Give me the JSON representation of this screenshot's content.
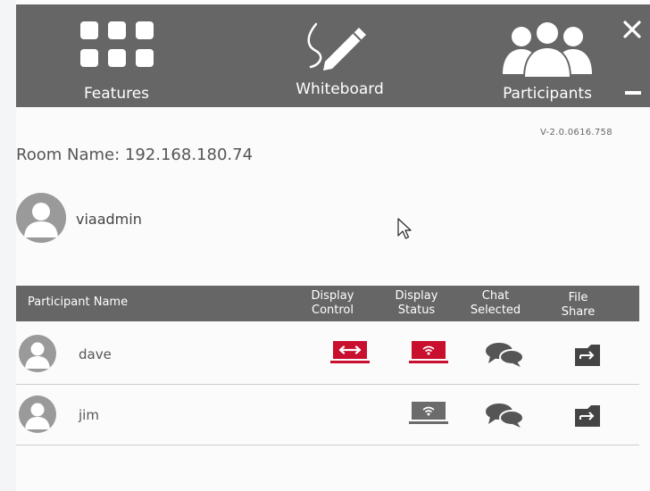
{
  "toolbar": {
    "features_label": "Features",
    "whiteboard_label": "Whiteboard",
    "participants_label": "Participants"
  },
  "version": "V-2.0.0616.758",
  "room": {
    "label": "Room Name:",
    "value": "192.168.180.74"
  },
  "current_user": {
    "name": "viaadmin"
  },
  "table": {
    "headers": {
      "name": "Participant Name",
      "display_control": [
        "Display",
        "Control"
      ],
      "display_status": [
        "Display",
        "Status"
      ],
      "chat_selected": [
        "Chat",
        "Selected"
      ],
      "file_share": [
        "File",
        "Share"
      ]
    },
    "rows": [
      {
        "name": "dave",
        "display_control": "active",
        "display_status": "active",
        "chat": true,
        "file_share": true
      },
      {
        "name": "jim",
        "display_control": "none",
        "display_status": "inactive",
        "chat": true,
        "file_share": true
      }
    ]
  },
  "colors": {
    "toolbar": "#666666",
    "active_red": "#c8102e",
    "inactive_gray": "#6b6b6b",
    "chat_gray": "#555555",
    "file_dark": "#444444"
  }
}
